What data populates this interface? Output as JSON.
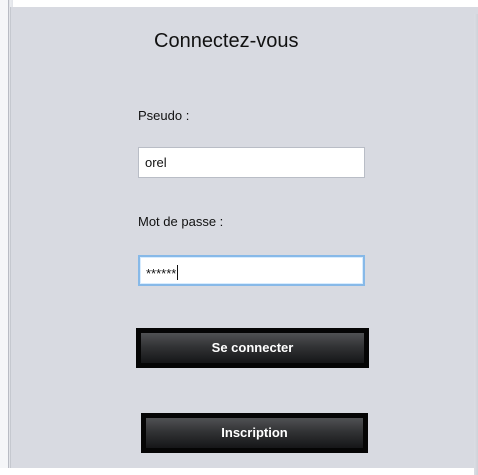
{
  "header": {
    "title": "Connectez-vous"
  },
  "form": {
    "pseudo_label": "Pseudo :",
    "pseudo_value": "orel",
    "password_label": "Mot de passe :",
    "password_value": "******"
  },
  "actions": {
    "connect_label": "Se connecter",
    "register_label": "Inscription"
  }
}
